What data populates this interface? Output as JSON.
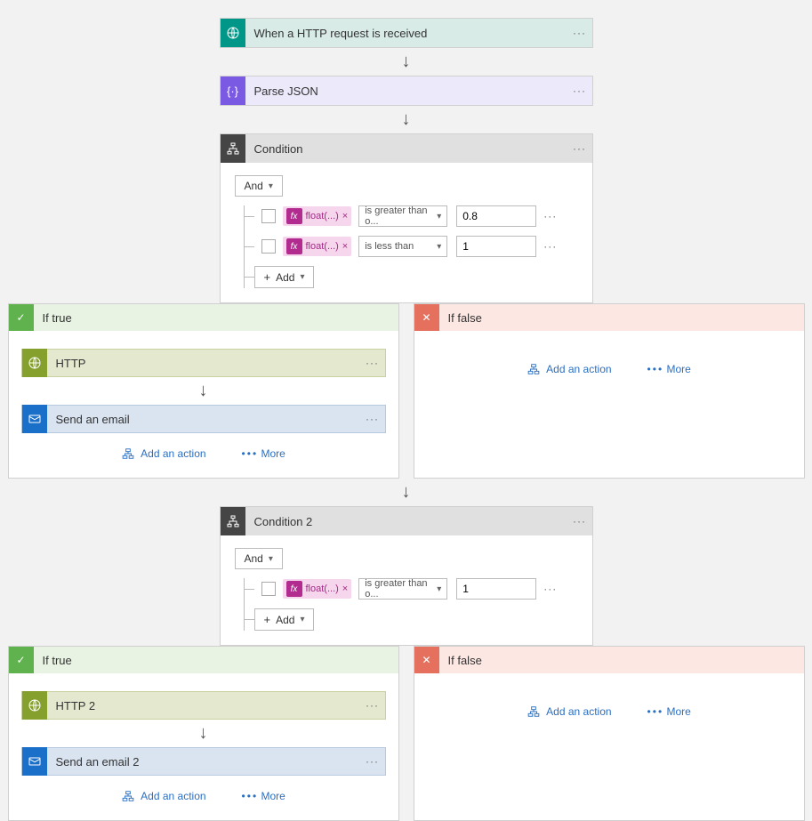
{
  "trigger": {
    "title": "When a HTTP request is received"
  },
  "parse": {
    "title": "Parse JSON"
  },
  "condition1": {
    "title": "Condition",
    "logic": "And",
    "rows": [
      {
        "pill": "float(...)",
        "op": "is greater than o...",
        "value": "0.8"
      },
      {
        "pill": "float(...)",
        "op": "is less than",
        "value": "1"
      }
    ],
    "add": "Add"
  },
  "branch1": {
    "true": {
      "label": "If true",
      "actions": [
        {
          "type": "http",
          "title": "HTTP"
        },
        {
          "type": "email",
          "title": "Send an email"
        }
      ]
    },
    "false": {
      "label": "If false"
    }
  },
  "condition2": {
    "title": "Condition 2",
    "logic": "And",
    "rows": [
      {
        "pill": "float(...)",
        "op": "is greater than o...",
        "value": "1"
      }
    ],
    "add": "Add"
  },
  "branch2": {
    "true": {
      "label": "If true",
      "actions": [
        {
          "type": "http",
          "title": "HTTP 2"
        },
        {
          "type": "email",
          "title": "Send an email 2"
        }
      ]
    },
    "false": {
      "label": "If false"
    }
  },
  "links": {
    "addAction": "Add an action",
    "more": "More"
  }
}
